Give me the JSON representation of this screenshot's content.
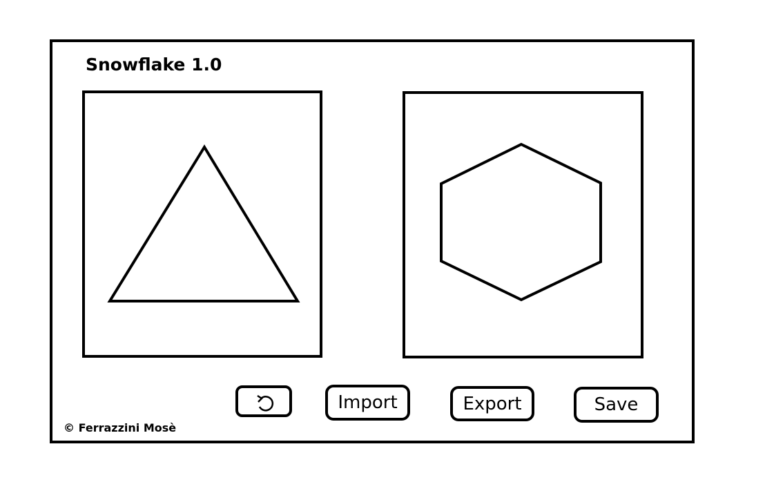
{
  "app": {
    "title": "Snowflake 1.0"
  },
  "panels": {
    "left": {
      "shape": "triangle"
    },
    "right": {
      "shape": "hexagon"
    }
  },
  "toolbar": {
    "reset_icon": "rotate-ccw-icon",
    "import_label": "Import",
    "export_label": "Export",
    "save_label": "Save"
  },
  "footer": {
    "credit": "© Ferrazzini Mosè"
  },
  "colors": {
    "ink": "#000000",
    "background": "#ffffff"
  }
}
